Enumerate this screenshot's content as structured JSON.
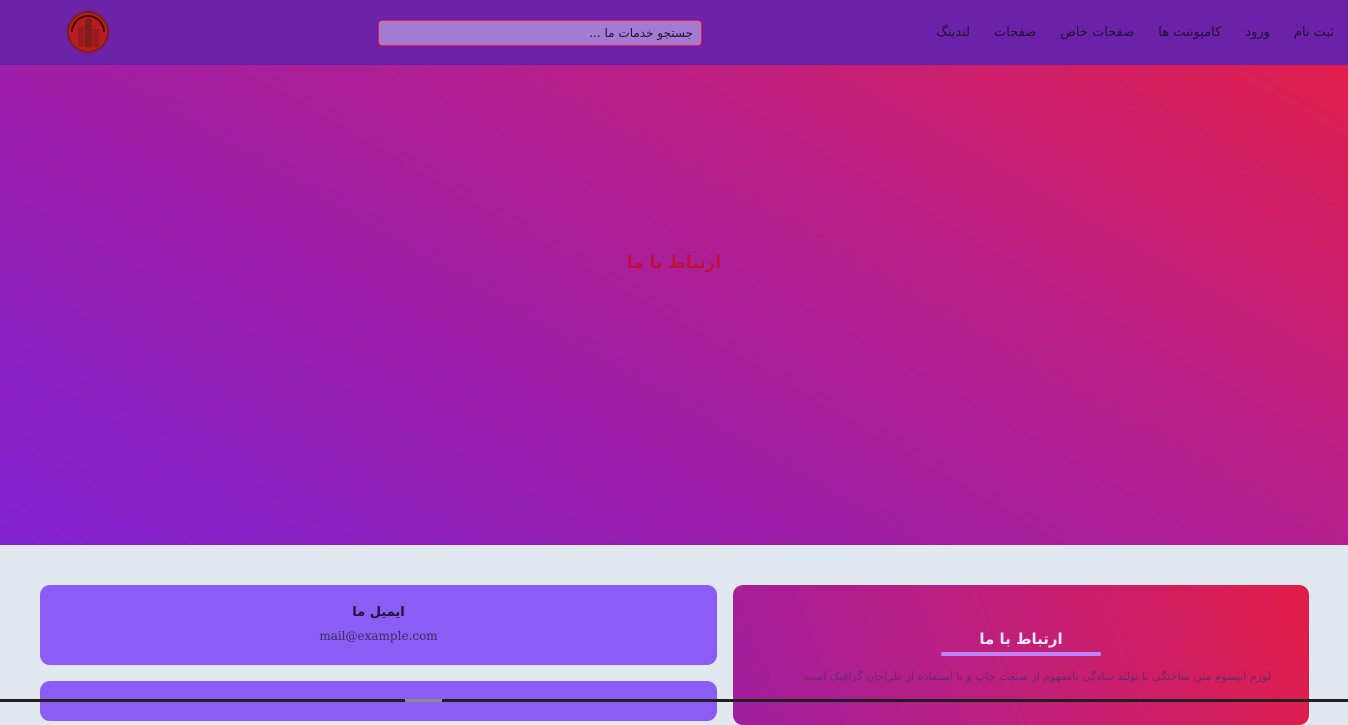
{
  "nav": {
    "links": [
      "لندینگ",
      "صفحات",
      "صفحات خاص",
      "کامپوننت ها",
      "ورود",
      "ثبت نام"
    ]
  },
  "search": {
    "placeholder": "جستجو خدمات ما ..."
  },
  "logo": {
    "icon": "logo-icon"
  },
  "hero": {
    "title": "ارتباط با ما"
  },
  "email_card": {
    "title": "ایمیل ما",
    "value": "mail@example.com"
  },
  "contact_card": {
    "title": "ارتباط با ما",
    "text": "لورم ایپسوم متن ساختگی با تولید سادگی نامفهوم از صنعت چاپ و با استفاده از طراحان گرافیک است"
  },
  "colors": {
    "navbar": "#6b21a8",
    "accent_red": "#e11d48",
    "accent_purple": "#8b5cf6",
    "page_bg": "#e2e8f0"
  }
}
